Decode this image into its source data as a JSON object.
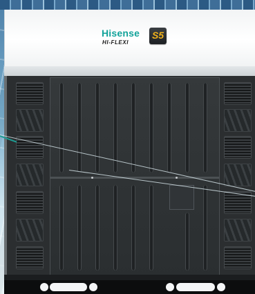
{
  "product": {
    "brand_name": "Hisense",
    "series_name": "HI-FLEXI",
    "model_badge": "S5",
    "brand_color": "#12a39a",
    "badge_color": "#f2b21a"
  }
}
